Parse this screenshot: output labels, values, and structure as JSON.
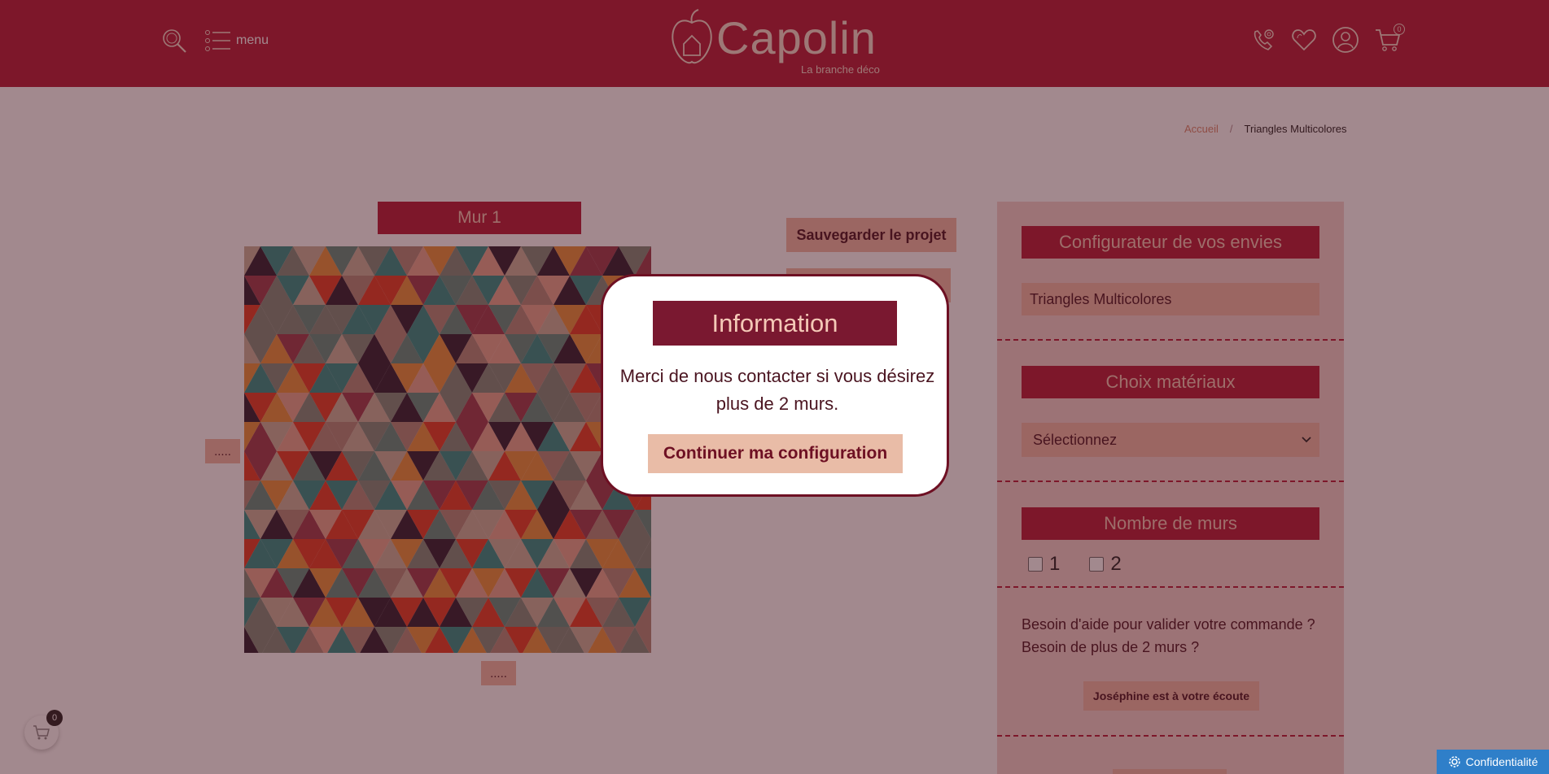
{
  "header": {
    "menu_label": "menu",
    "logo_text": "Capolin",
    "logo_subtitle": "La branche déco",
    "cart_count": "0"
  },
  "breadcrumb": {
    "home": "Accueil",
    "separator": "/",
    "current": "Triangles Multicolores"
  },
  "wall": {
    "title": "Mur 1",
    "height_placeholder": ".....",
    "width_placeholder": "....."
  },
  "actions": {
    "save": "Sauvegarder le projet"
  },
  "panel": {
    "configurator_title": "Configurateur de vos envies",
    "product_name": "Triangles Multicolores",
    "materials_title": "Choix matériaux",
    "materials_select": "Sélectionnez",
    "walls_title": "Nombre de murs",
    "walls_options": [
      "1",
      "2"
    ],
    "help_line1": "Besoin d'aide pour valider votre commande ?",
    "help_line2": "Besoin de plus de 2 murs ?",
    "contact_button": "Joséphine est à votre écoute"
  },
  "floating_cart": {
    "count": "0"
  },
  "modal": {
    "title": "Information",
    "message": "Merci de nous contacter si vous désirez plus de 2 murs.",
    "button": "Continuer ma configuration"
  },
  "privacy": {
    "label": "Confidentialité"
  },
  "colors": {
    "brand": "#b51a36",
    "accent": "#f0b9a7",
    "modal_title_bg": "#7a1830",
    "privacy_blue": "#2f7fc9"
  },
  "icons": [
    "search-icon",
    "menu-list-icon",
    "phone-icon",
    "heart-icon",
    "user-icon",
    "cart-icon",
    "chevron-down-icon",
    "gear-icon"
  ]
}
